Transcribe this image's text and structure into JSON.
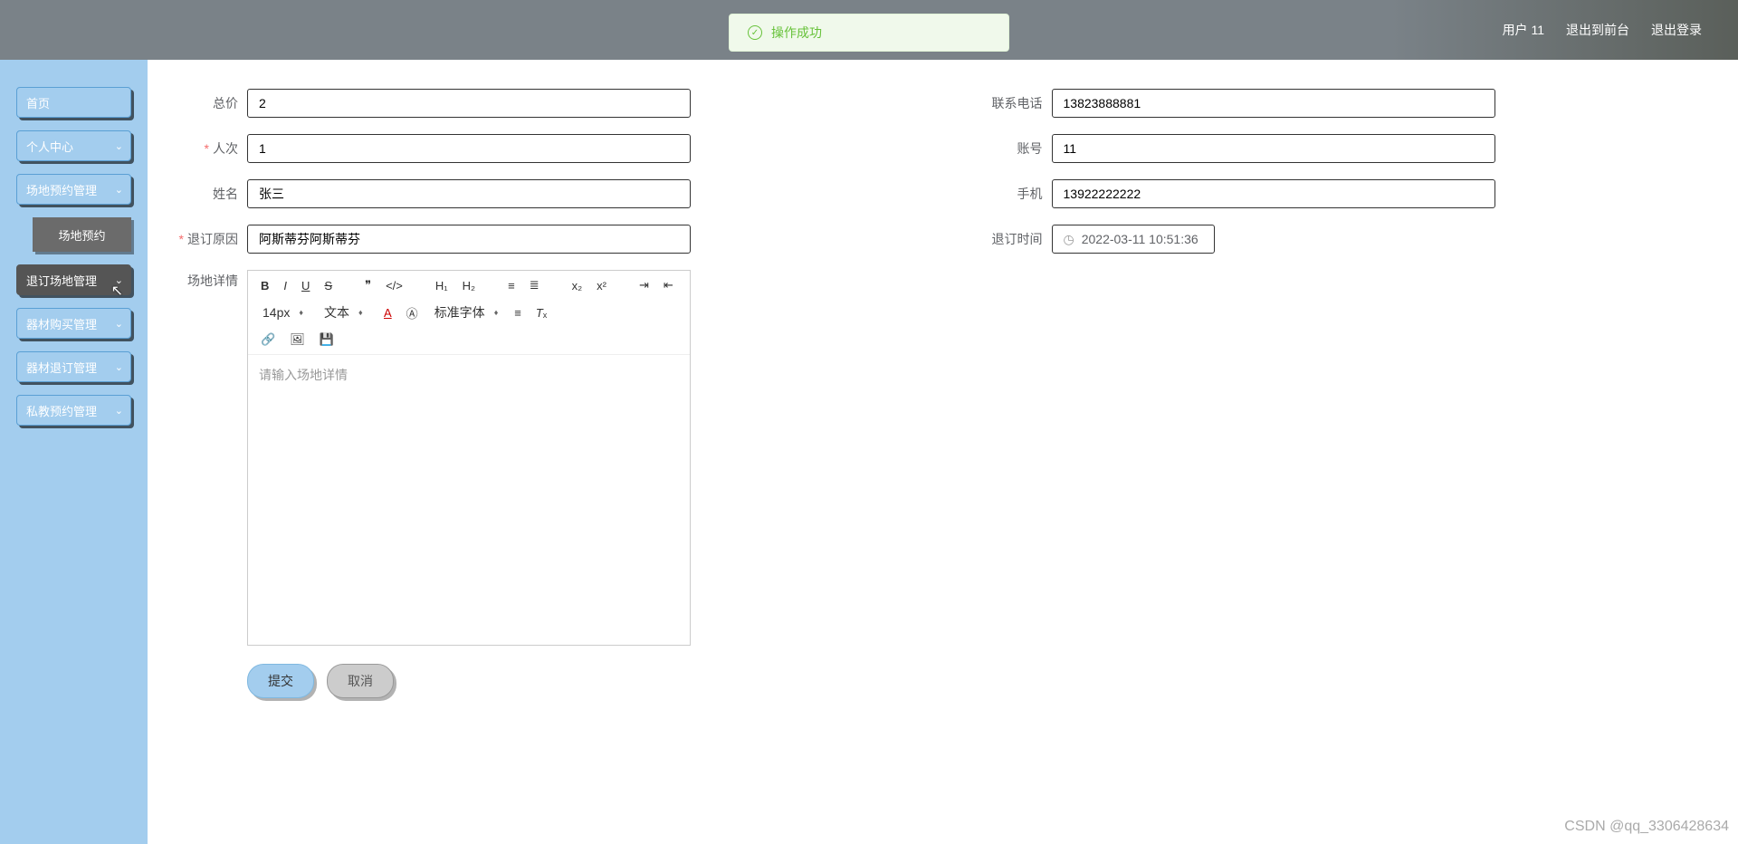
{
  "header": {
    "user_label": "用户 11",
    "exit_front": "退出到前台",
    "logout": "退出登录"
  },
  "toast": {
    "message": "操作成功"
  },
  "sidebar": {
    "items": [
      {
        "label": "首页",
        "has_chevron": false
      },
      {
        "label": "个人中心",
        "has_chevron": true
      },
      {
        "label": "场地预约管理",
        "has_chevron": true
      },
      {
        "label": "退订场地管理",
        "has_chevron": true,
        "dark": true
      },
      {
        "label": "器材购买管理",
        "has_chevron": true
      },
      {
        "label": "器材退订管理",
        "has_chevron": true
      },
      {
        "label": "私教预约管理",
        "has_chevron": true
      }
    ],
    "submenu_label": "场地预约"
  },
  "form": {
    "total_price": {
      "label": "总价",
      "value": "2"
    },
    "contact_phone": {
      "label": "联系电话",
      "value": "13823888881"
    },
    "person_count": {
      "label": "人次",
      "value": "1"
    },
    "account": {
      "label": "账号",
      "value": "11"
    },
    "name": {
      "label": "姓名",
      "value": "张三"
    },
    "mobile": {
      "label": "手机",
      "value": "13922222222"
    },
    "cancel_reason": {
      "label": "退订原因",
      "value": "阿斯蒂芬阿斯蒂芬"
    },
    "cancel_time": {
      "label": "退订时间",
      "value": "2022-03-11 10:51:36"
    },
    "venue_details": {
      "label": "场地详情",
      "placeholder": "请输入场地详情"
    }
  },
  "editor": {
    "font_size": "14px",
    "text_type": "文本",
    "font_family": "标准字体"
  },
  "buttons": {
    "submit": "提交",
    "cancel": "取消"
  },
  "watermark": "CSDN @qq_3306428634"
}
